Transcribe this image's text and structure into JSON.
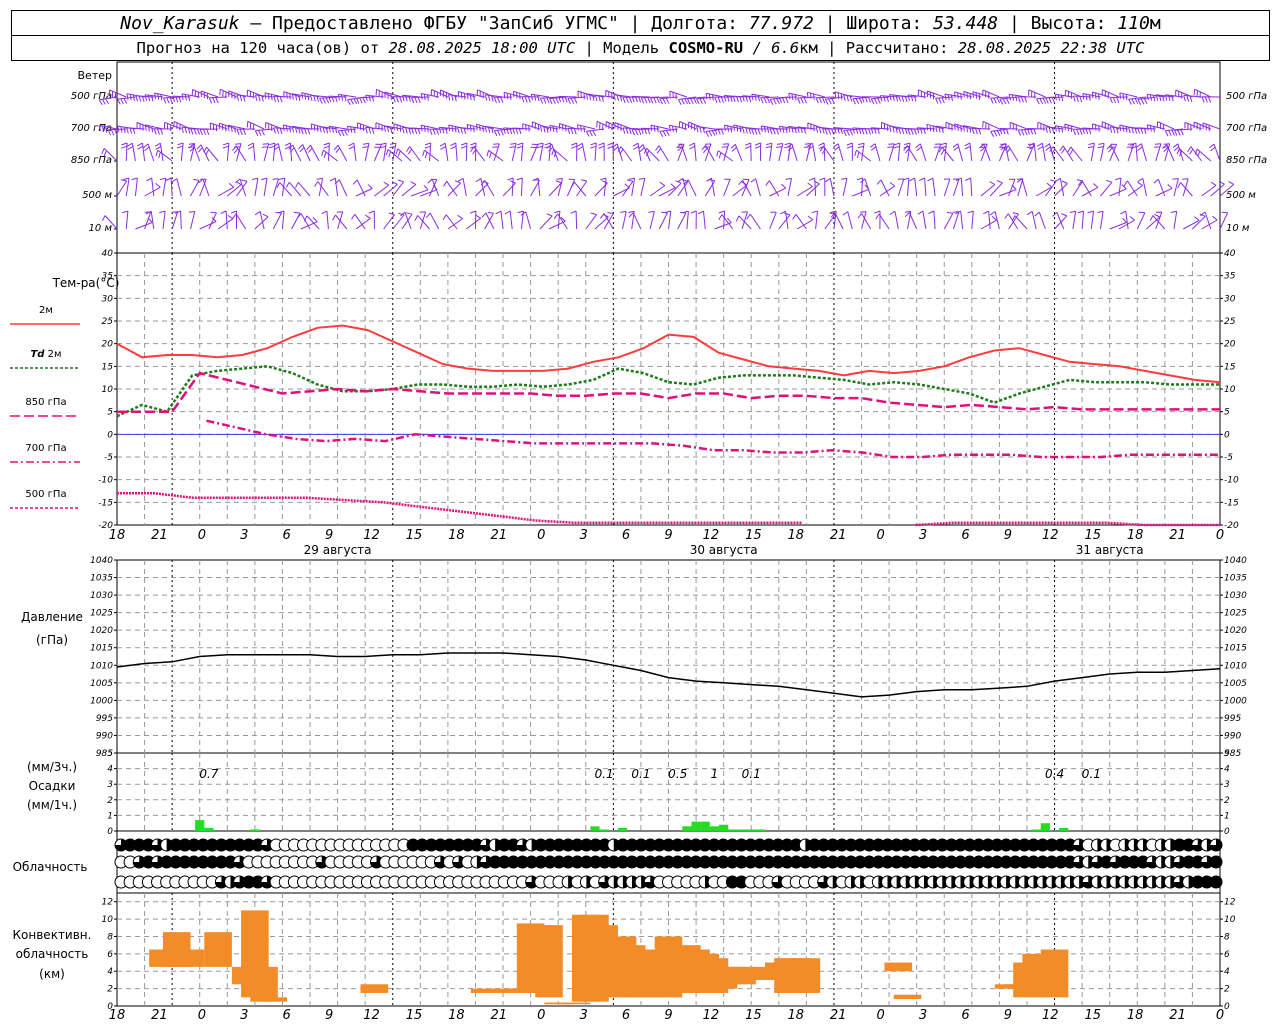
{
  "header": {
    "station": "Nov_Karasuk",
    "sep1": " – Предоставлено ФГБУ \"ЗапСиб УГМС\" | Долгота: ",
    "lon": "77.972",
    "sep2": " | Широта: ",
    "lat": "53.448",
    "sep3": " | Высота: ",
    "alt": "110",
    "alt_unit": "м",
    "forecast_prefix": "Прогноз на 120 часа(ов) от ",
    "forecast_time": "28.08.2025 18:00 UTC",
    "model_prefix": "  | Модель ",
    "model_name": "COSMO-RU",
    "model_res": " / 6.6",
    "model_res_unit": "км",
    "calc_prefix": " | Рассчитано: ",
    "calc_time": "28.08.2025 22:38 UTC"
  },
  "colors": {
    "wind": "#8a2be2",
    "t2m": "#ff3b3b",
    "td2m": "#1c7c1c",
    "t850": "#e0107a",
    "t700": "#e0107a",
    "t500": "#e0107a",
    "zero_line": "#3a3af0",
    "precip": "#22dd22",
    "conv": "#f28c28",
    "pressure": "#000000",
    "grid": "#999999"
  },
  "x_ticks": [
    "18",
    "21",
    "0",
    "3",
    "6",
    "9",
    "12",
    "15",
    "18",
    "21",
    "0",
    "3",
    "6",
    "9",
    "12",
    "15",
    "18",
    "21",
    "0",
    "3",
    "6",
    "9",
    "12",
    "15",
    "18",
    "21",
    "0"
  ],
  "date_labels": [
    "29 августа",
    "30 августа",
    "31 августа"
  ],
  "wind_panel": {
    "title": "Ветер",
    "levels": [
      "500 гПа",
      "700 гПа",
      "850 гПа",
      "500 м",
      "10 м"
    ]
  },
  "temp_panel": {
    "title": "Тем-ра(°C)",
    "legend": [
      {
        "label": "2м"
      },
      {
        "label_a": "Td",
        "label_b": " 2м"
      },
      {
        "label": "850 гПа"
      },
      {
        "label": "700 гПа"
      },
      {
        "label": "500 гПа"
      }
    ]
  },
  "pressure_panel": {
    "title": "Давление",
    "unit": "(гПа)"
  },
  "precip_panel": {
    "unit3": "(мм/3ч.)",
    "title": "Осадки",
    "unit1": "(мм/1ч.)"
  },
  "cloud_panel": {
    "title": "Облачность"
  },
  "conv_panel": {
    "title1": "Конвективн.",
    "title2": "облачность",
    "unit": "(км)"
  },
  "chart_data": [
    {
      "type": "line",
      "name": "temperature",
      "ylabel": "Тем-ра(°C)",
      "ylim": [
        -20,
        40
      ],
      "yticks": [
        -20,
        -15,
        -10,
        -5,
        0,
        5,
        10,
        15,
        20,
        25,
        30,
        35,
        40
      ],
      "x_hours_from_start": [
        0,
        3,
        6,
        9,
        12,
        15,
        18,
        21,
        24,
        27,
        30,
        33,
        36,
        39,
        42,
        45,
        48,
        51,
        54,
        57,
        60,
        63,
        66,
        69,
        72,
        75,
        78,
        81,
        84,
        87,
        90,
        93,
        96,
        99,
        102,
        105,
        108,
        111,
        114,
        117,
        120
      ],
      "series": [
        {
          "name": "2м",
          "values": [
            20,
            17,
            17.5,
            17.5,
            17,
            17.5,
            19,
            21.5,
            23.5,
            24,
            23,
            20.5,
            18,
            15.5,
            14.5,
            14,
            14,
            14,
            14.5,
            16,
            17,
            19,
            22,
            21.5,
            18,
            16.5,
            15,
            14.5,
            14,
            13,
            14,
            13.5,
            14,
            15,
            17,
            18.5,
            19,
            17.5,
            16,
            15.5,
            15,
            14,
            13,
            12,
            11.5
          ]
        },
        {
          "name": "Td 2м",
          "values": [
            4,
            6.5,
            5,
            13,
            14,
            14.5,
            15,
            13.5,
            11,
            9.5,
            9.5,
            10,
            11,
            11,
            10.5,
            10.5,
            11,
            10.5,
            11,
            12,
            14.5,
            13.5,
            11.5,
            11,
            12.5,
            13,
            13,
            13,
            12.5,
            12,
            11,
            11.5,
            11,
            10,
            9,
            7,
            9,
            10.5,
            12,
            11.5,
            11.5,
            11.5,
            11,
            11,
            11
          ]
        },
        {
          "name": "850 гПа",
          "values": [
            5,
            5,
            5,
            13.5,
            12,
            10.5,
            9,
            9.5,
            10,
            9.5,
            10,
            9.5,
            9,
            9,
            9,
            9,
            8.5,
            8.5,
            9,
            9,
            8,
            9,
            9,
            8,
            8.5,
            8.5,
            8,
            8,
            7,
            6.5,
            6,
            6.5,
            6,
            5.5,
            6,
            5.5,
            5.5,
            5.5,
            5.5,
            5.5,
            5.5
          ]
        },
        {
          "name": "700 гПа",
          "values": [
            null,
            null,
            null,
            3,
            1.5,
            0,
            -1,
            -1.5,
            -1,
            -1.5,
            0,
            -0.5,
            -1,
            -1.5,
            -2,
            -2,
            -2,
            -2,
            -2,
            -2.5,
            -3.5,
            -3.5,
            -4,
            -4,
            -3.5,
            -4,
            -5,
            -5,
            -4.5,
            -4.5,
            -4.5,
            -5,
            -5,
            -5,
            -4.5,
            -4.5,
            -4.5,
            -4.5
          ]
        },
        {
          "name": "500 гПа",
          "values": [
            -13,
            -13,
            -14,
            -14,
            -14,
            -14,
            -14.5,
            -15,
            -16,
            -17,
            -18,
            -19,
            -19.5,
            -19.5,
            -19.5,
            -19.5,
            -19.5,
            -19.5,
            -19.5,
            null,
            null,
            -20,
            -19.5,
            -19.5,
            -19.5,
            -19.5,
            -19.5,
            -20,
            -20,
            -20
          ]
        }
      ]
    },
    {
      "type": "line",
      "name": "pressure",
      "ylabel": "Давление (гПа)",
      "ylim": [
        985,
        1040
      ],
      "yticks": [
        985,
        990,
        995,
        1000,
        1005,
        1010,
        1015,
        1020,
        1025,
        1030,
        1035,
        1040
      ],
      "x_hours_from_start": [
        0,
        3,
        6,
        9,
        12,
        15,
        18,
        21,
        24,
        27,
        30,
        33,
        36,
        39,
        42,
        45,
        48,
        51,
        54,
        57,
        60,
        63,
        66,
        69,
        72,
        75,
        78,
        81,
        84,
        87,
        90,
        93,
        96,
        99,
        102,
        105,
        108,
        111,
        114,
        117,
        120
      ],
      "values": [
        1009.5,
        1010.5,
        1011,
        1012.5,
        1013,
        1013,
        1013,
        1013,
        1012.5,
        1012.5,
        1013,
        1013,
        1013.5,
        1013.5,
        1013.5,
        1013,
        1012.5,
        1011.5,
        1010,
        1008.5,
        1006.5,
        1005.5,
        1005,
        1004.5,
        1004,
        1003,
        1002,
        1001,
        1001.5,
        1002.5,
        1003,
        1003,
        1003.5,
        1004,
        1005.5,
        1006.5,
        1007.5,
        1008,
        1008,
        1008.5,
        1009
      ]
    },
    {
      "type": "bar",
      "name": "precipitation",
      "ylabel": "Осадки (мм/1ч.)",
      "ylim": [
        0,
        5
      ],
      "yticks": [
        0,
        1,
        2,
        3,
        4,
        5
      ],
      "x_hours_from_start": [
        9,
        10,
        15,
        52,
        53,
        55,
        62,
        63,
        64,
        65,
        66,
        67,
        68,
        69,
        70,
        100,
        101,
        103
      ],
      "values": [
        0.7,
        0.2,
        0.1,
        0.3,
        0.1,
        0.2,
        0.3,
        0.6,
        0.6,
        0.3,
        0.4,
        0.1,
        0.1,
        0.1,
        0.1,
        0.1,
        0.5,
        0.2
      ],
      "annotations": [
        {
          "hour": 10,
          "text": "0.7"
        },
        {
          "hour": 53,
          "text": "0.1"
        },
        {
          "hour": 57,
          "text": "0.1"
        },
        {
          "hour": 61,
          "text": "0.5"
        },
        {
          "hour": 65,
          "text": "1"
        },
        {
          "hour": 69,
          "text": "0.1"
        },
        {
          "hour": 102,
          "text": "0.4"
        },
        {
          "hour": 106,
          "text": "0.1"
        }
      ]
    },
    {
      "type": "bar",
      "name": "convective_cloud",
      "ylabel": "Конвективн. облачность (км)",
      "ylim": [
        0,
        13
      ],
      "yticks": [
        0,
        2,
        4,
        6,
        8,
        10,
        12
      ],
      "bars": [
        {
          "h": 4,
          "base": 4.5,
          "top": 6.5
        },
        {
          "h": 5.5,
          "base": 4.5,
          "top": 8.5
        },
        {
          "h": 7,
          "base": 4.5,
          "top": 6.5
        },
        {
          "h": 10,
          "base": 4.5,
          "top": 8.5
        },
        {
          "h": 13,
          "base": 2.5,
          "top": 4.5
        },
        {
          "h": 14,
          "base": 1,
          "top": 11
        },
        {
          "h": 15,
          "base": 0.5,
          "top": 4.5
        },
        {
          "h": 16,
          "base": 0.5,
          "top": 1
        },
        {
          "h": 27,
          "base": 1.5,
          "top": 2.5
        },
        {
          "h": 39,
          "base": 1.5,
          "top": 2
        },
        {
          "h": 41,
          "base": 1.5,
          "top": 2
        },
        {
          "h": 43,
          "base": 1.5,
          "top": 2
        },
        {
          "h": 44,
          "base": 1.5,
          "top": 9.5
        },
        {
          "h": 45,
          "base": 1.5,
          "top": 9.3
        },
        {
          "h": 46,
          "base": 1,
          "top": 9.3
        },
        {
          "h": 47,
          "base": 0.2,
          "top": 0.4
        },
        {
          "h": 49,
          "base": 0.2,
          "top": 0.4
        },
        {
          "h": 50,
          "base": 0.5,
          "top": 10.5
        },
        {
          "h": 51,
          "base": 0.5,
          "top": 10.5
        },
        {
          "h": 52,
          "base": 1,
          "top": 9.3
        },
        {
          "h": 54,
          "base": 1,
          "top": 8
        },
        {
          "h": 55,
          "base": 1,
          "top": 7
        },
        {
          "h": 56,
          "base": 1,
          "top": 6.5
        },
        {
          "h": 57,
          "base": 1,
          "top": 6.5
        },
        {
          "h": 58,
          "base": 1,
          "top": 6.5
        },
        {
          "h": 59,
          "base": 1,
          "top": 8
        },
        {
          "h": 60,
          "base": 1.5,
          "top": 6
        },
        {
          "h": 61,
          "base": 1.5,
          "top": 7
        },
        {
          "h": 62,
          "base": 1.5,
          "top": 6.5
        },
        {
          "h": 63,
          "base": 1.5,
          "top": 6
        },
        {
          "h": 64,
          "base": 1.5,
          "top": 5.5
        },
        {
          "h": 65,
          "base": 2,
          "top": 4.5
        },
        {
          "h": 66,
          "base": 2.5,
          "top": 4.5
        },
        {
          "h": 67,
          "base": 2.5,
          "top": 4.5
        },
        {
          "h": 68,
          "base": 3,
          "top": 4.5
        },
        {
          "h": 69,
          "base": 3,
          "top": 4
        },
        {
          "h": 70,
          "base": 3,
          "top": 4
        },
        {
          "h": 71,
          "base": 3,
          "top": 5
        },
        {
          "h": 72,
          "base": 1.5,
          "top": 5.5
        },
        {
          "h": 73,
          "base": 1.5,
          "top": 5.5
        },
        {
          "h": 74,
          "base": 1.5,
          "top": 5.5
        },
        {
          "h": 84,
          "base": 4,
          "top": 5
        },
        {
          "h": 85,
          "base": 0.8,
          "top": 1.3
        },
        {
          "h": 96,
          "base": 2,
          "top": 2.5
        },
        {
          "h": 97,
          "base": 2,
          "top": 2.5
        },
        {
          "h": 98,
          "base": 1,
          "top": 5
        },
        {
          "h": 99,
          "base": 1,
          "top": 6
        },
        {
          "h": 101,
          "base": 1,
          "top": 6.5
        }
      ]
    }
  ],
  "cloud_rows": {
    "note": "cloud fraction symbols per hour, 0..4 eighths-quarters (0 empty,1 quarter,2 half,3 three-quarters,4 full)",
    "high": [
      3,
      4,
      4,
      4,
      3,
      2,
      4,
      4,
      4,
      4,
      4,
      4,
      4,
      4,
      4,
      4,
      3,
      0,
      0,
      0,
      0,
      0,
      0,
      0,
      0,
      0,
      0,
      0,
      0,
      0,
      0,
      0,
      4,
      4,
      4,
      4,
      4,
      4,
      4,
      4,
      3,
      2,
      4,
      4,
      3,
      2,
      4,
      4,
      4,
      4,
      4,
      4,
      4,
      4,
      2,
      4,
      4,
      4,
      4,
      4,
      4,
      4,
      4,
      4,
      4,
      4,
      4,
      4,
      4,
      4,
      4,
      4,
      4,
      4,
      4,
      2,
      4,
      4,
      4,
      4,
      4,
      4,
      4,
      4,
      4,
      4,
      4,
      4,
      4,
      4,
      4,
      4,
      4,
      4,
      4,
      4,
      4,
      4,
      4,
      4,
      4,
      4,
      4,
      4,
      4,
      3,
      0,
      2,
      2,
      0,
      2,
      2,
      2,
      0,
      2,
      2,
      4,
      4,
      3,
      2,
      3
    ],
    "mid": [
      0,
      0,
      3,
      4,
      3,
      4,
      4,
      4,
      4,
      4,
      4,
      4,
      4,
      3,
      0,
      0,
      0,
      0,
      0,
      0,
      0,
      0,
      3,
      0,
      0,
      0,
      0,
      0,
      3,
      0,
      0,
      0,
      0,
      0,
      0,
      3,
      0,
      3,
      0,
      2,
      3,
      4,
      4,
      4,
      4,
      4,
      4,
      4,
      4,
      4,
      4,
      4,
      4,
      4,
      4,
      4,
      4,
      4,
      4,
      4,
      4,
      4,
      4,
      4,
      4,
      4,
      4,
      4,
      4,
      4,
      4,
      4,
      4,
      4,
      4,
      4,
      4,
      4,
      4,
      4,
      4,
      4,
      4,
      4,
      4,
      4,
      4,
      4,
      4,
      4,
      4,
      4,
      4,
      4,
      4,
      4,
      4,
      4,
      4,
      4,
      4,
      4,
      4,
      4,
      4,
      3,
      2,
      3,
      4,
      3,
      4,
      4,
      4,
      3,
      2,
      2,
      3,
      4,
      4,
      3,
      4
    ],
    "low": [
      0,
      0,
      0,
      0,
      0,
      0,
      0,
      0,
      0,
      0,
      0,
      3,
      2,
      3,
      4,
      4,
      3,
      0,
      0,
      0,
      0,
      0,
      0,
      0,
      0,
      0,
      0,
      0,
      0,
      0,
      0,
      0,
      0,
      0,
      0,
      0,
      0,
      0,
      0,
      0,
      0,
      0,
      0,
      0,
      0,
      3,
      0,
      0,
      0,
      2,
      0,
      2,
      0,
      3,
      2,
      2,
      2,
      2,
      3,
      0,
      0,
      0,
      0,
      0,
      2,
      0,
      0,
      4,
      4,
      0,
      0,
      0,
      3,
      0,
      0,
      0,
      0,
      3,
      2,
      0,
      2,
      2,
      0,
      2,
      2,
      2,
      2,
      2,
      2,
      2,
      2,
      2,
      2,
      2,
      2,
      2,
      2,
      2,
      2,
      2,
      2,
      2,
      2,
      2,
      2,
      2,
      3,
      2,
      2,
      2,
      2,
      2,
      2,
      2,
      2,
      2,
      3,
      2,
      4,
      4,
      4
    ]
  }
}
